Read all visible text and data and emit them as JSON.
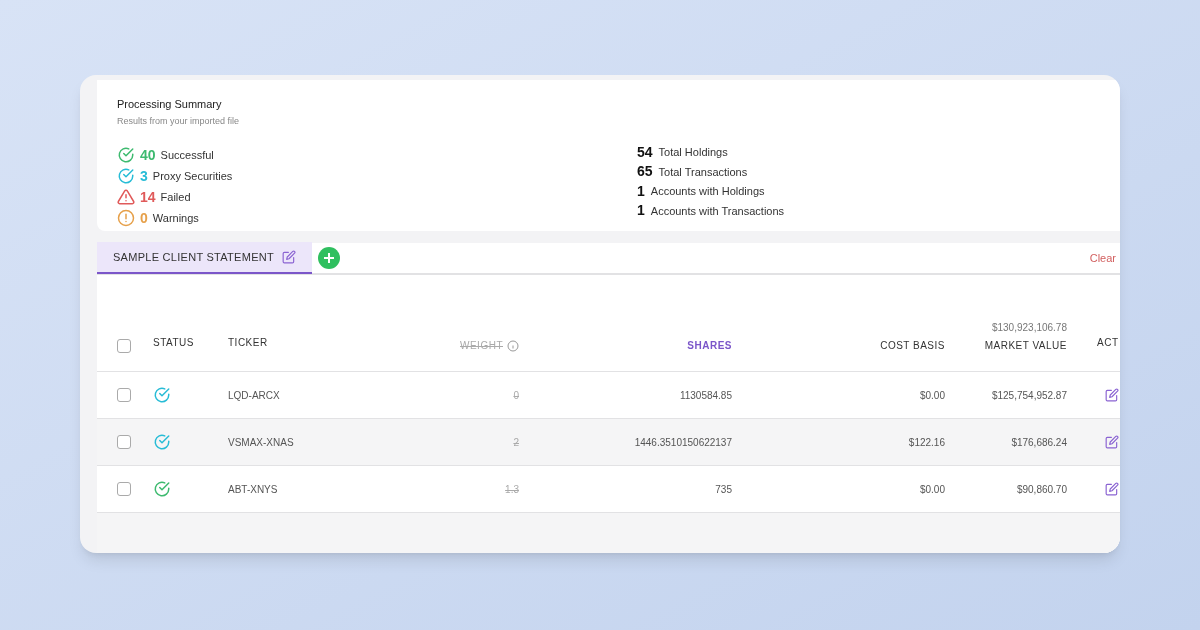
{
  "summary": {
    "title": "Processing Summary",
    "subtitle": "Results from your imported file",
    "statuses": [
      {
        "kind": "success",
        "count": "40",
        "label": "Successful",
        "color": "#3dba6f"
      },
      {
        "kind": "proxy",
        "count": "3",
        "label": "Proxy Securities",
        "color": "#27bcd6"
      },
      {
        "kind": "failed",
        "count": "14",
        "label": "Failed",
        "color": "#e05a5a"
      },
      {
        "kind": "warning",
        "count": "0",
        "label": "Warnings",
        "color": "#e6a04a"
      }
    ],
    "totals": [
      {
        "count": "54",
        "label": "Total Holdings"
      },
      {
        "count": "65",
        "label": "Total Transactions"
      },
      {
        "count": "1",
        "label": "Accounts with Holdings"
      },
      {
        "count": "1",
        "label": "Accounts with Transactions"
      }
    ]
  },
  "tabs": [
    {
      "label": "SAMPLE CLIENT STATEMENT",
      "selected": true
    }
  ],
  "clear_link": "Clear",
  "table": {
    "columns": [
      {
        "label": "STATUS"
      },
      {
        "label": "TICKER"
      },
      {
        "label": "WEIGHT",
        "disabled": true
      },
      {
        "label": "SHARES",
        "selected": true
      },
      {
        "label": "COST BASIS",
        "selected": false
      },
      {
        "label": "MARKET VALUE",
        "total": "$130,923,106.78",
        "selected": false
      },
      {
        "label": "ACT"
      }
    ],
    "select_all_checked": false,
    "rows": [
      {
        "kind": "proxy",
        "ticker": "LQD-ARCX",
        "weight": "0",
        "shares": "1130584.85",
        "cost_basis": "$0.00",
        "market_value": "$125,754,952.87",
        "checked": false
      },
      {
        "kind": "proxy",
        "ticker": "VSMAX-XNAS",
        "weight": "2",
        "shares": "1446.3510150622137",
        "cost_basis": "$122.16",
        "market_value": "$176,686.24",
        "checked": false
      },
      {
        "kind": "success",
        "ticker": "ABT-XNYS",
        "weight": "1.3",
        "shares": "735",
        "cost_basis": "$0.00",
        "market_value": "$90,860.70",
        "checked": false
      }
    ]
  }
}
